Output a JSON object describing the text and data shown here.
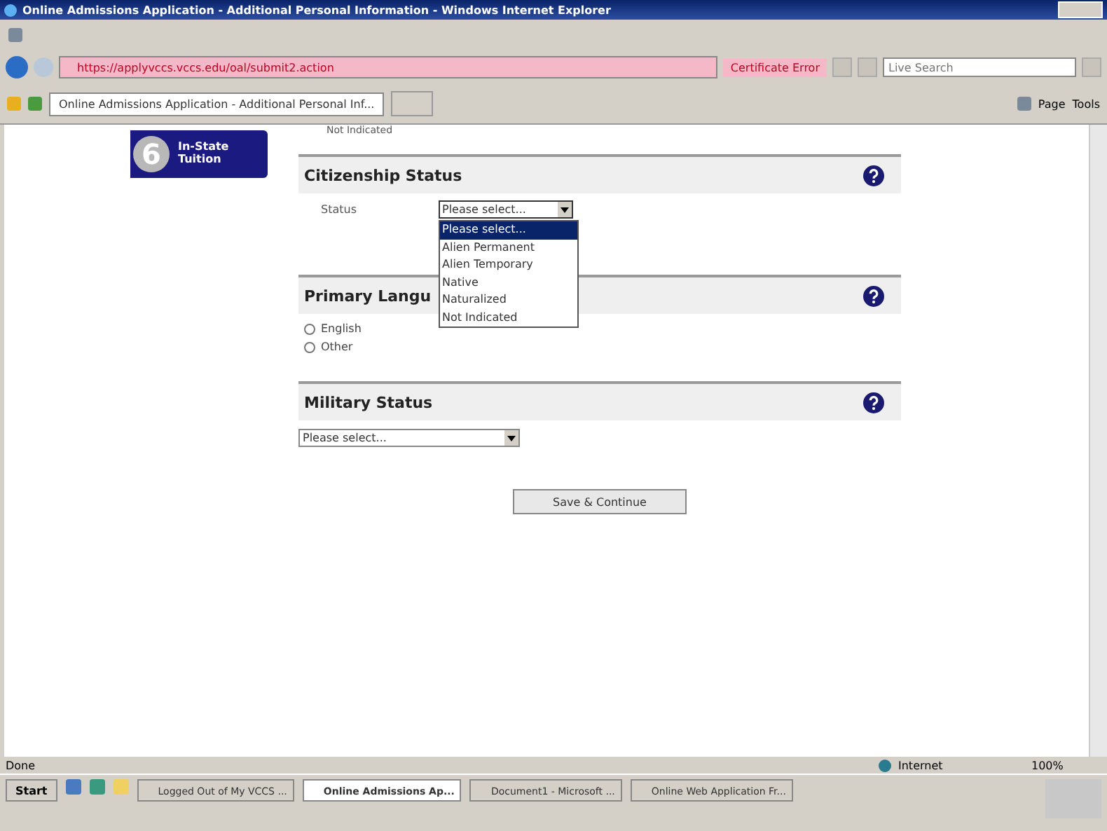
{
  "window": {
    "title": "Online Admissions Application - Additional Personal Information - Windows Internet Explorer"
  },
  "address_bar": {
    "url": "https://applyvccs.vccs.edu/oal/submit2.action",
    "certificate": "Certificate Error",
    "search_placeholder": "Live Search"
  },
  "tabs": [
    {
      "label": "Online Admissions Application - Additional Personal Inf...",
      "selected": true
    }
  ],
  "tools": [
    "Page",
    "Tools"
  ],
  "nav_step": {
    "number": "6",
    "label": "In-State Tuition"
  },
  "top_cut_text": "Not Indicated",
  "sections": [
    {
      "kind": "select_labeled",
      "title": "Citizenship Status",
      "label": "Status",
      "value": "Please select...",
      "expanded": true,
      "options": [
        {
          "label": "Please select...",
          "selected": true
        },
        {
          "label": "Alien Permanent",
          "selected": false
        },
        {
          "label": "Alien Temporary",
          "selected": false
        },
        {
          "label": "Native",
          "selected": false
        },
        {
          "label": "Naturalized",
          "selected": false
        },
        {
          "label": "Not Indicated",
          "selected": false
        }
      ]
    },
    {
      "kind": "radios",
      "title": "Primary Langu",
      "options": [
        {
          "label": "English",
          "selected": false
        },
        {
          "label": "Other",
          "selected": false
        }
      ]
    },
    {
      "kind": "select",
      "title": "Military Status",
      "value": "Please select...",
      "expanded": false
    }
  ],
  "submit": "Save & Continue",
  "status_bar": {
    "text": "Done",
    "zone": "Internet",
    "zoom": "100%"
  },
  "taskbar": {
    "start": "Start",
    "items": [
      {
        "label": "Logged Out of My VCCS ...",
        "selected": false
      },
      {
        "label": "Online Admissions Ap...",
        "selected": true
      },
      {
        "label": "Document1 - Microsoft ...",
        "selected": false
      },
      {
        "label": "Online Web Application Fr...",
        "selected": false
      }
    ]
  }
}
